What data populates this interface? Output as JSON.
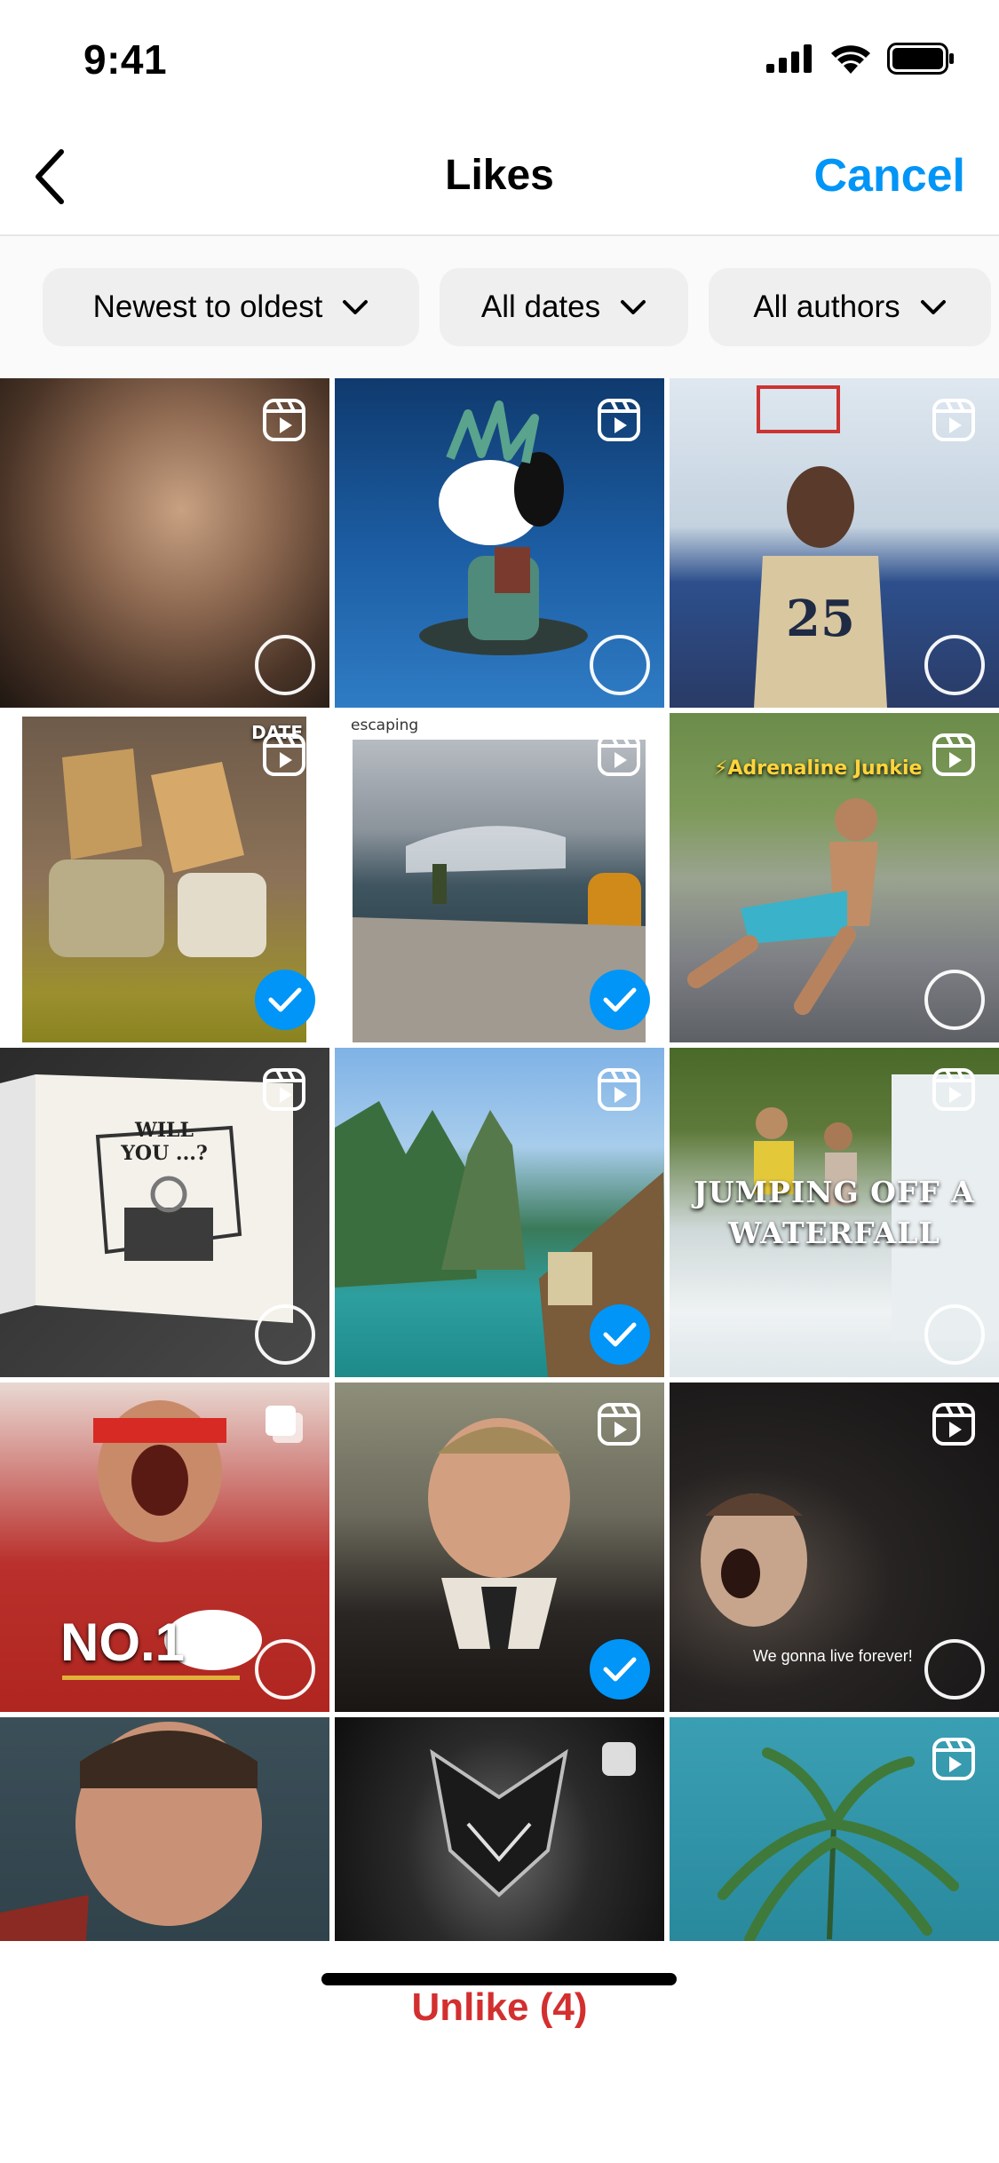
{
  "status_bar": {
    "time": "9:41"
  },
  "nav": {
    "title": "Likes",
    "cancel_label": "Cancel"
  },
  "filters": [
    {
      "label": "Newest to oldest"
    },
    {
      "label": "All dates"
    },
    {
      "label": "All authors"
    }
  ],
  "tiles": [
    {
      "kind": "reel",
      "selected": false,
      "caption": ""
    },
    {
      "kind": "reel",
      "selected": false,
      "caption": ""
    },
    {
      "kind": "reel",
      "selected": false,
      "caption": ""
    },
    {
      "kind": "reel",
      "selected": true,
      "caption": "DATE"
    },
    {
      "kind": "reel",
      "selected": true,
      "caption": "escaping"
    },
    {
      "kind": "reel",
      "selected": false,
      "caption": "⚡Adrenaline Junkie"
    },
    {
      "kind": "reel",
      "selected": false,
      "caption": "WILL YOU ...?"
    },
    {
      "kind": "reel",
      "selected": true,
      "caption": ""
    },
    {
      "kind": "reel",
      "selected": false,
      "caption": "JUMPING OFF A WATERFALL"
    },
    {
      "kind": "carousel",
      "selected": false,
      "caption": "NO.1"
    },
    {
      "kind": "reel",
      "selected": true,
      "caption": ""
    },
    {
      "kind": "reel",
      "selected": false,
      "caption": "We gonna live forever!"
    },
    {
      "kind": "none",
      "selected": false,
      "caption": ""
    },
    {
      "kind": "post",
      "selected": false,
      "caption": ""
    },
    {
      "kind": "reel",
      "selected": false,
      "caption": ""
    }
  ],
  "bottom": {
    "unlike_label": "Unlike (4)"
  },
  "colors": {
    "accent": "#0095f6",
    "destructive": "#d32f2f"
  }
}
